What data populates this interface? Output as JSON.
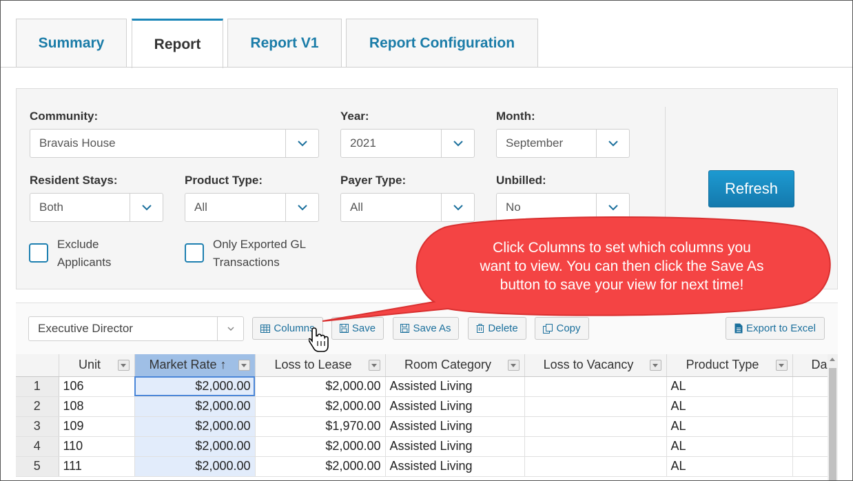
{
  "tabs": [
    {
      "label": "Summary",
      "active": false
    },
    {
      "label": "Report",
      "active": true
    },
    {
      "label": "Report V1",
      "active": false
    },
    {
      "label": "Report Configuration",
      "active": false
    }
  ],
  "filters": {
    "community": {
      "label": "Community:",
      "value": "Bravais House"
    },
    "year": {
      "label": "Year:",
      "value": "2021"
    },
    "month": {
      "label": "Month:",
      "value": "September"
    },
    "resident_stays": {
      "label": "Resident Stays:",
      "value": "Both"
    },
    "product_type": {
      "label": "Product Type:",
      "value": "All"
    },
    "payer_type": {
      "label": "Payer Type:",
      "value": "All"
    },
    "unbilled": {
      "label": "Unbilled:",
      "value": "No"
    },
    "exclude_applicants": {
      "label_line1": "Exclude",
      "label_line2": "Applicants",
      "checked": false
    },
    "only_exported": {
      "label_line1": "Only Exported GL",
      "label_line2": "Transactions",
      "checked": false
    },
    "refresh_label": "Refresh"
  },
  "toolbar": {
    "view_value": "Executive Director",
    "columns_label": "Columns",
    "save_label": "Save",
    "save_as_label": "Save As",
    "delete_label": "Delete",
    "copy_label": "Copy",
    "export_label": "Export to Excel"
  },
  "callout": {
    "line1": "Click Columns to set which columns you",
    "line2": "want to view. You can then click the Save As",
    "line3": "button to save your view for next time!",
    "color": "#f44444"
  },
  "grid": {
    "headers": [
      "Unit",
      "Market Rate",
      "Loss to Lease",
      "Room Category",
      "Loss to Vacancy",
      "Product Type",
      "Da"
    ],
    "sort_indicator": "↑",
    "rows": [
      {
        "n": "1",
        "unit": "106",
        "market_rate": "$2,000.00",
        "loss_to_lease": "$2,000.00",
        "room_category": "Assisted Living",
        "loss_to_vacancy": "",
        "product_type": "AL"
      },
      {
        "n": "2",
        "unit": "108",
        "market_rate": "$2,000.00",
        "loss_to_lease": "$2,000.00",
        "room_category": "Assisted Living",
        "loss_to_vacancy": "",
        "product_type": "AL"
      },
      {
        "n": "3",
        "unit": "109",
        "market_rate": "$2,000.00",
        "loss_to_lease": "$1,970.00",
        "room_category": "Assisted Living",
        "loss_to_vacancy": "",
        "product_type": "AL"
      },
      {
        "n": "4",
        "unit": "110",
        "market_rate": "$2,000.00",
        "loss_to_lease": "$2,000.00",
        "room_category": "Assisted Living",
        "loss_to_vacancy": "",
        "product_type": "AL"
      },
      {
        "n": "5",
        "unit": "111",
        "market_rate": "$2,000.00",
        "loss_to_lease": "$2,000.00",
        "room_category": "Assisted Living",
        "loss_to_vacancy": "",
        "product_type": "AL"
      }
    ]
  },
  "colors": {
    "accent": "#1a7ca8",
    "refresh": "#1a8fc6",
    "sorted_header": "#9fbfe6"
  }
}
